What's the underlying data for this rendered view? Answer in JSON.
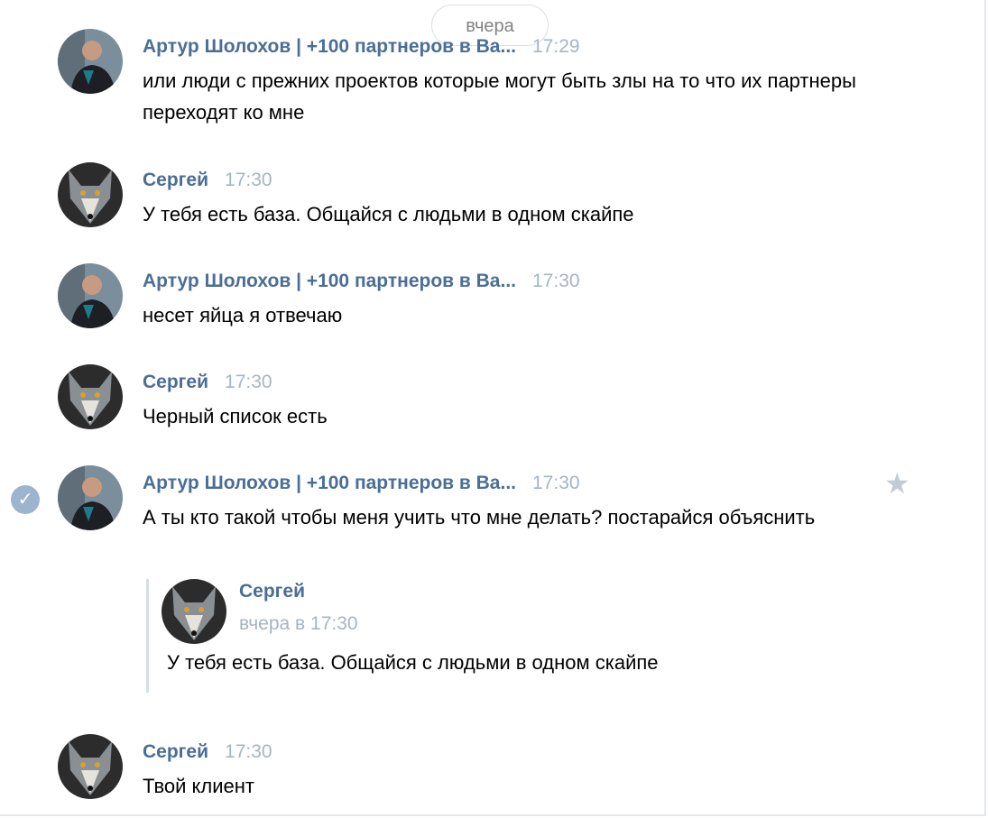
{
  "date_divider": "вчера",
  "messages": [
    {
      "author": "Артур Шолохов | +100 партнеров в Ва...",
      "time": "17:29",
      "text": "или люди с прежних проектов которые могут быть злы на то что их партнеры переходят ко мне"
    },
    {
      "author": "Сергей",
      "time": "17:30",
      "text": "У тебя есть база. Общайся с людьми в одном скайпе"
    },
    {
      "author": "Артур Шолохов | +100 партнеров в Ва...",
      "time": "17:30",
      "text": "несет яйца я отвечаю"
    },
    {
      "author": "Сергей",
      "time": "17:30",
      "text": "Черный список есть"
    },
    {
      "author": "Артур Шолохов | +100 партнеров в Ва...",
      "time": "17:30",
      "text": "А ты кто такой чтобы меня учить что мне делать? постарайся объяснить",
      "forwarded": {
        "author": "Сергей",
        "time": "вчера в 17:30",
        "text": "У тебя есть база. Общайся с людьми в одном скайпе"
      }
    },
    {
      "author": "Сергей",
      "time": "17:30",
      "text": "Твой клиент"
    }
  ],
  "icons": {
    "selected": "check-circle-icon",
    "favorite": "star-icon"
  },
  "colors": {
    "author": "#4a6e97",
    "time": "#a6b4c4",
    "check": "#9db4cf",
    "star": "#c3cad3"
  }
}
